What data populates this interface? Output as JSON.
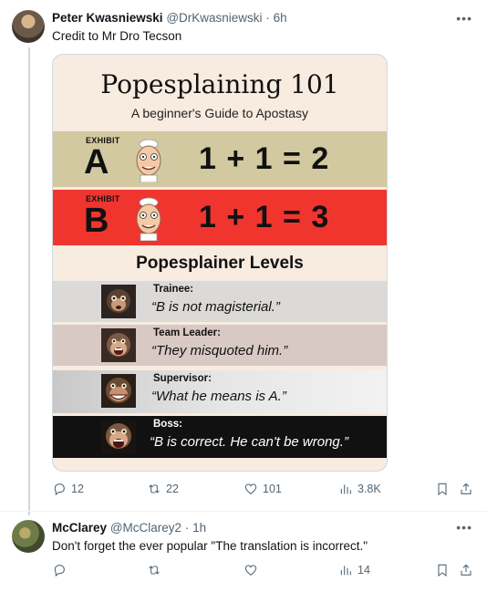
{
  "tweet1": {
    "name": "Peter Kwasniewski",
    "handle": "@DrKwasniewski",
    "dot": "·",
    "time": "6h",
    "more_icon": "more-horizontal-icon",
    "text": "Credit to Mr Dro Tecson",
    "meme": {
      "title": "Popesplaining 101",
      "subtitle": "A beginner's Guide to Apostasy",
      "exhibits": [
        {
          "word": "EXHIBIT",
          "letter": "A",
          "equation": "1 + 1 = 2",
          "color": "#d2c9a0"
        },
        {
          "word": "EXHIBIT",
          "letter": "B",
          "equation": "1 + 1 = 3",
          "color": "#f0352f"
        }
      ],
      "levels_title": "Popesplainer Levels",
      "levels": [
        {
          "role": "Trainee:",
          "quote": "“B is not magisterial.”"
        },
        {
          "role": "Team Leader:",
          "quote": "“They misquoted him.”"
        },
        {
          "role": "Supervisor:",
          "quote": "“What he means is A.”"
        },
        {
          "role": "Boss:",
          "quote": "“B is correct. He can't be wrong.”"
        }
      ]
    },
    "actions": {
      "replies": "12",
      "reposts": "22",
      "likes": "101",
      "views": "3.8K"
    }
  },
  "tweet2": {
    "name": "McClarey",
    "handle": "@McClarey2",
    "dot": "·",
    "time": "1h",
    "text": "Don't forget the ever popular \"The translation is incorrect.\"",
    "actions": {
      "replies": "",
      "reposts": "",
      "likes": "",
      "views": "14"
    }
  },
  "colors": {
    "text_primary": "#0f1419",
    "text_secondary": "#536471",
    "border": "#cfd9de",
    "exhibit_a": "#d2c9a0",
    "exhibit_b": "#f0352f"
  }
}
